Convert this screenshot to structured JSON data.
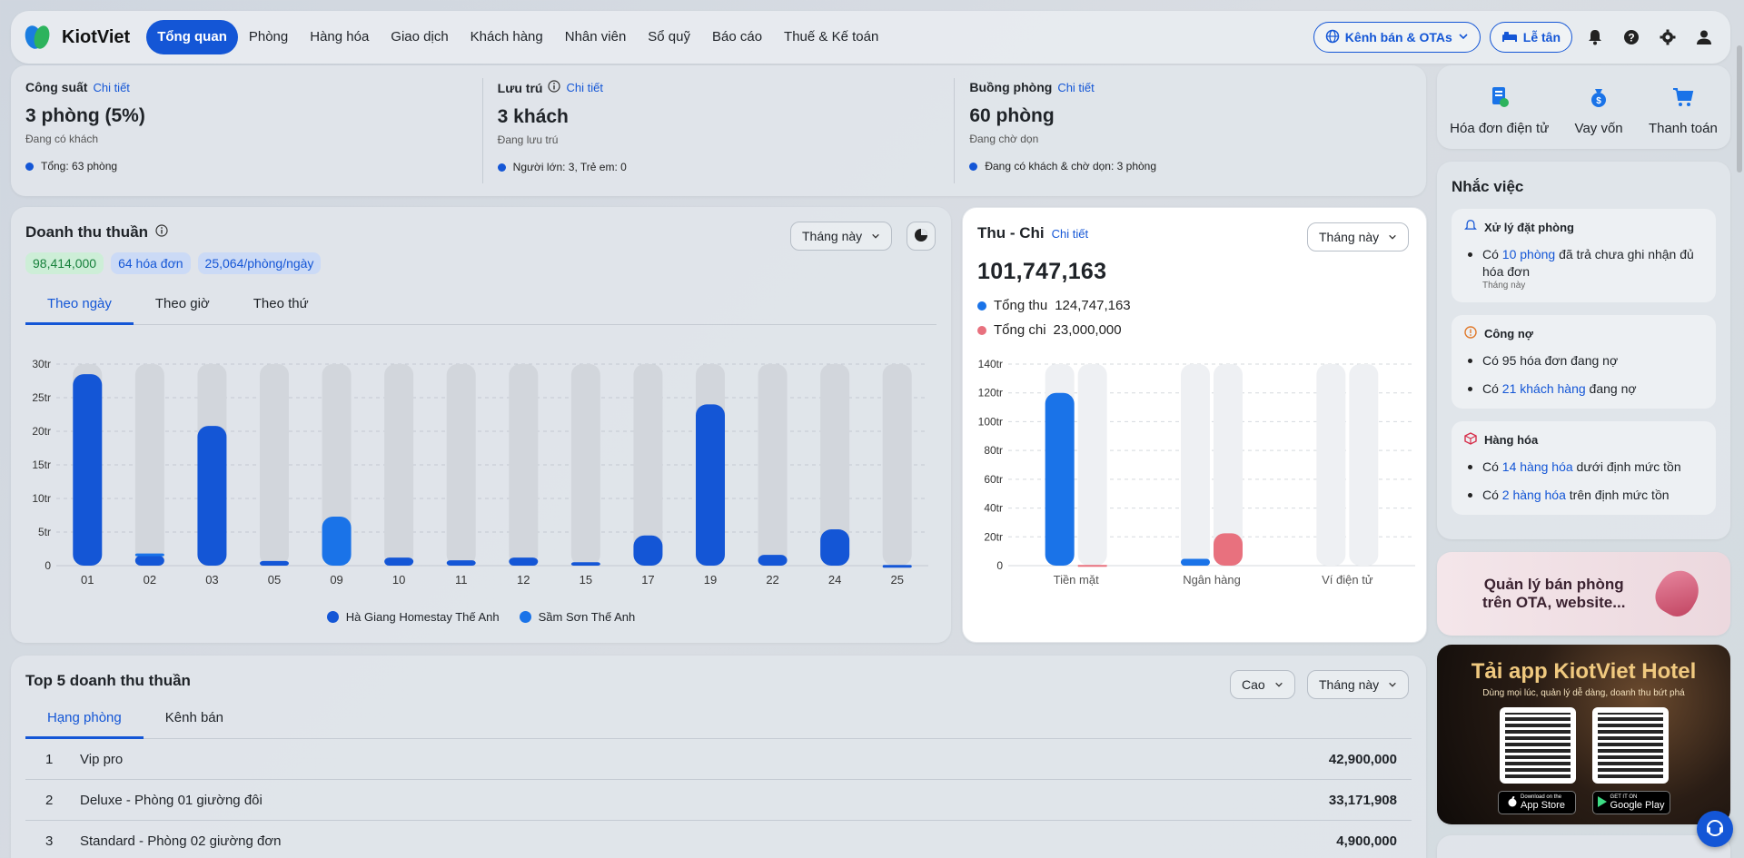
{
  "nav": {
    "brand": "KiotViet",
    "items": [
      "Tổng quan",
      "Phòng",
      "Hàng hóa",
      "Giao dịch",
      "Khách hàng",
      "Nhân viên",
      "Sổ quỹ",
      "Báo cáo",
      "Thuế & Kế toán"
    ],
    "active": "Tổng quan",
    "channels_label": "Kênh bán & OTAs",
    "reception_label": "Lễ tân"
  },
  "summary": {
    "capacity": {
      "title": "Công suất",
      "link": "Chi tiết",
      "value": "3 phòng (5%)",
      "sub": "Đang có khách",
      "foot": "Tổng: 63 phòng"
    },
    "stay": {
      "title": "Lưu trú",
      "link": "Chi tiết",
      "value": "3 khách",
      "sub": "Đang lưu trú",
      "foot": "Người lớn: 3,  Trẻ em: 0"
    },
    "rooms": {
      "title": "Buồng phòng",
      "link": "Chi tiết",
      "value": "60 phòng",
      "sub": "Đang chờ dọn",
      "foot": "Đang có khách & chờ dọn: 3 phòng"
    }
  },
  "revenue": {
    "title": "Doanh thu thuần",
    "period": "Tháng này",
    "badges": {
      "total": "98,414,000",
      "invoices": "64 hóa đơn",
      "per_room": "25,064/phòng/ngày"
    },
    "tabs": [
      "Theo ngày",
      "Theo giờ",
      "Theo thứ"
    ],
    "active_tab": "Theo ngày"
  },
  "thuchi": {
    "title": "Thu - Chi",
    "link": "Chi tiết",
    "period": "Tháng này",
    "net": "101,747,163",
    "income_label": "Tổng thu",
    "income_value": "124,747,163",
    "expense_label": "Tổng chi",
    "expense_value": "23,000,000"
  },
  "quick": {
    "items": [
      "Hóa đơn điện tử",
      "Vay vốn",
      "Thanh toán"
    ]
  },
  "reminder": {
    "title": "Nhắc việc",
    "booking": {
      "title": "Xử lý đặt phòng",
      "pre": "Có ",
      "link": "10 phòng",
      "post": " đã trả chưa ghi nhận đủ hóa đơn",
      "note": "Tháng này"
    },
    "debt": {
      "title": "Công nợ",
      "line1": "Có 95 hóa đơn đang nợ",
      "l2_pre": "Có ",
      "l2_link": "21 khách hàng",
      "l2_post": " đang nợ"
    },
    "goods": {
      "title": "Hàng hóa",
      "l1_pre": "Có ",
      "l1_link": "14 hàng hóa",
      "l1_post": " dưới định mức tồn",
      "l2_pre": "Có ",
      "l2_link": "2 hàng hóa",
      "l2_post": " trên định mức tồn"
    }
  },
  "promo": {
    "ota_line1": "Quản lý bán phòng",
    "ota_line2": "trên OTA, website...",
    "app_title": "Tải app KiotViet Hotel",
    "app_sub": "Dùng mọi lúc, quản lý dễ dàng, doanh thu bứt phá",
    "appstore_small": "Download on the",
    "appstore": "App Store",
    "gplay_small": "GET IT ON",
    "gplay": "Google Play"
  },
  "top5": {
    "title": "Top 5 doanh thu thuần",
    "sort": "Cao",
    "period": "Tháng này",
    "tabs": [
      "Hạng phòng",
      "Kênh bán"
    ],
    "rows": [
      {
        "rank": "1",
        "name": "Vip pro",
        "value": "42,900,000"
      },
      {
        "rank": "2",
        "name": "Deluxe - Phòng 01 giường đôi",
        "value": "33,171,908"
      },
      {
        "rank": "3",
        "name": "Standard - Phòng 02 giường đơn",
        "value": "4,900,000"
      }
    ]
  },
  "colors": {
    "primary": "#1456d6",
    "series2": "#1a73e8",
    "income": "#1a73e8",
    "expense": "#e8717e",
    "green": "#17803b"
  },
  "chart_data": [
    {
      "type": "bar",
      "title": "Doanh thu thuần",
      "categories": [
        "01",
        "02",
        "03",
        "05",
        "09",
        "10",
        "11",
        "12",
        "15",
        "17",
        "19",
        "22",
        "24",
        "25"
      ],
      "series": [
        {
          "name": "Hà Giang Homestay Thế Anh",
          "values": [
            28.5,
            1.5,
            20.8,
            0.7,
            0,
            1.2,
            0.8,
            1.2,
            0.5,
            4.5,
            24,
            1.6,
            5.4,
            0.1
          ]
        },
        {
          "name": "Sầm Sơn Thế Anh",
          "values": [
            0,
            0.3,
            0,
            0,
            7.3,
            0,
            0,
            0,
            0,
            0,
            0,
            0,
            0,
            0
          ]
        }
      ],
      "yticks": [
        "0",
        "5tr",
        "10tr",
        "15tr",
        "20tr",
        "25tr",
        "30tr"
      ],
      "ylim": [
        0,
        30
      ],
      "stacked": true,
      "grid": true,
      "legend": "bottom"
    },
    {
      "type": "bar",
      "title": "Thu - Chi",
      "categories": [
        "Tiền mặt",
        "Ngân hàng",
        "Ví điện tử"
      ],
      "series": [
        {
          "name": "Tổng thu",
          "values": [
            120,
            4.7,
            0
          ]
        },
        {
          "name": "Tổng chi",
          "values": [
            0.5,
            22.5,
            0
          ]
        }
      ],
      "yticks": [
        "0",
        "20tr",
        "40tr",
        "60tr",
        "80tr",
        "100tr",
        "120tr",
        "140tr"
      ],
      "ylim": [
        0,
        140
      ],
      "grid": true
    }
  ]
}
